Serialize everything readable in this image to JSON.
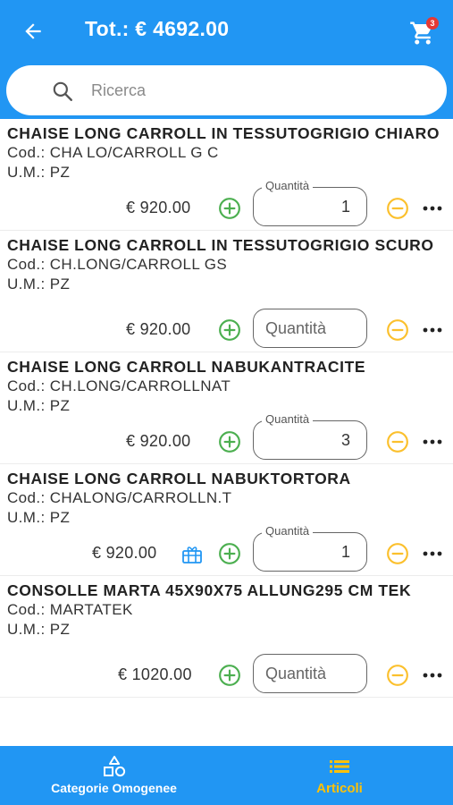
{
  "header": {
    "title": "Tot.: € 4692.00",
    "cart_count": "3",
    "bg_color": "#2196f3"
  },
  "search": {
    "placeholder": "Ricerca",
    "value": ""
  },
  "qty_label": "Quantità",
  "items": [
    {
      "name": "CHAISE LONG CARROLL IN TESSUTOGRIGIO CHIARO",
      "code": "Cod.: CHA LO/CARROLL G C",
      "um": "U.M.: PZ",
      "price": "€ 920.00",
      "qty": "1",
      "has_gift": false
    },
    {
      "name": "CHAISE LONG CARROLL IN TESSUTOGRIGIO SCURO",
      "code": "Cod.: CH.LONG/CARROLL GS",
      "um": "U.M.: PZ",
      "price": "€ 920.00",
      "qty": "",
      "has_gift": false
    },
    {
      "name": "CHAISE LONG CARROLL NABUKANTRACITE",
      "code": "Cod.: CH.LONG/CARROLLNAT",
      "um": "U.M.: PZ",
      "price": "€ 920.00",
      "qty": "3",
      "has_gift": false
    },
    {
      "name": "CHAISE LONG CARROLL NABUKTORTORA",
      "code": "Cod.: CHALONG/CARROLLN.T",
      "um": "U.M.: PZ",
      "price": "€ 920.00",
      "qty": "1",
      "has_gift": true
    },
    {
      "name": "CONSOLLE MARTA 45X90X75 ALLUNG295 CM TEK",
      "code": "Cod.: MARTATEK",
      "um": "U.M.: PZ",
      "price": "€ 1020.00",
      "qty": "",
      "has_gift": false
    }
  ],
  "icons": {
    "back": "arrow-back-icon",
    "cart": "cart-icon",
    "search": "search-icon",
    "plus": "plus-circle-icon",
    "minus": "minus-circle-icon",
    "more": "more-horizontal-icon",
    "gift": "gift-icon"
  },
  "tabs": [
    {
      "label": "Categorie Omogenee",
      "icon": "shapes-icon",
      "active": false
    },
    {
      "label": "Articoli",
      "icon": "list-icon",
      "active": true
    }
  ],
  "colors": {
    "primary": "#2196f3",
    "plus": "#4caf50",
    "minus": "#fbc02d",
    "active_tab": "#ffc107",
    "badge": "#e53935"
  }
}
